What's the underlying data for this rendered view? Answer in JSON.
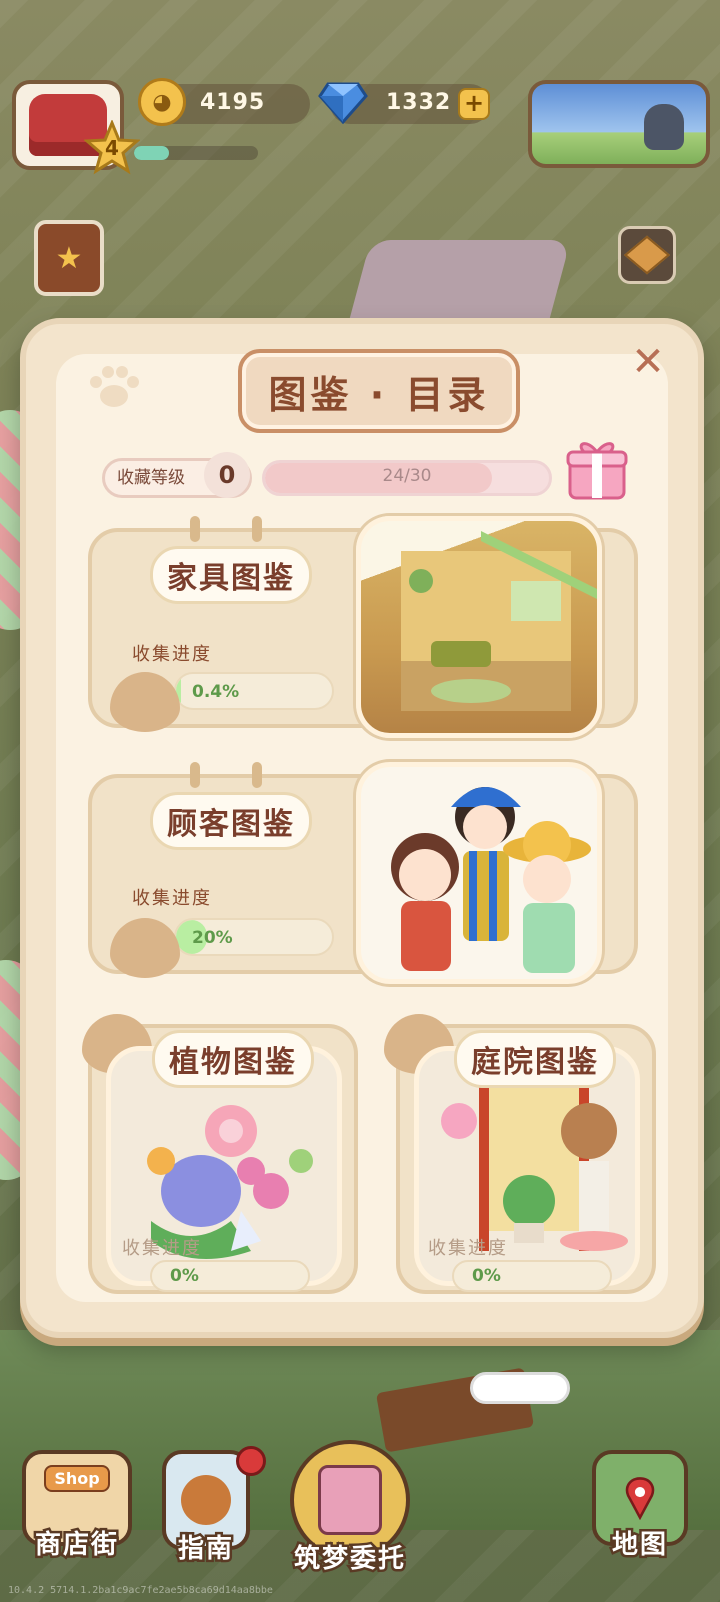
{
  "hud": {
    "level": "4",
    "xp_progress": 0.28,
    "coins": "4195",
    "gems": "1332",
    "gem_plus": "+"
  },
  "panel": {
    "title": "图鉴 · 目录",
    "close": "✕",
    "collection_level_label": "收藏等级",
    "collection_level": "0",
    "collection_progress_text": "24/30",
    "collection_progress": 0.8
  },
  "cards": [
    {
      "title": "家具图鉴",
      "progress_label": "收集进度",
      "progress_text": "0.4%",
      "progress": 0.004
    },
    {
      "title": "顾客图鉴",
      "progress_label": "收集进度",
      "progress_text": "20%",
      "progress": 0.2
    },
    {
      "title": "植物图鉴",
      "progress_label": "收集进度",
      "progress_text": "0%",
      "progress": 0
    },
    {
      "title": "庭院图鉴",
      "progress_label": "收集进度",
      "progress_text": "0%",
      "progress": 0
    }
  ],
  "bottom_nav": {
    "shop_sign": "Shop",
    "shop_street": "商店街",
    "guide": "指南",
    "dream_commission": "筑梦委托",
    "map": "地图"
  },
  "footer_id": "10.4.2 5714.1.2ba1c9ac7fe2ae5b8ca69d14aa8bbe",
  "colors": {
    "panel_bg": "#fbf2e2",
    "title_text": "#8a4b2e",
    "progress_fill": "#b9eea2",
    "progress_text": "#5e9a4a"
  }
}
